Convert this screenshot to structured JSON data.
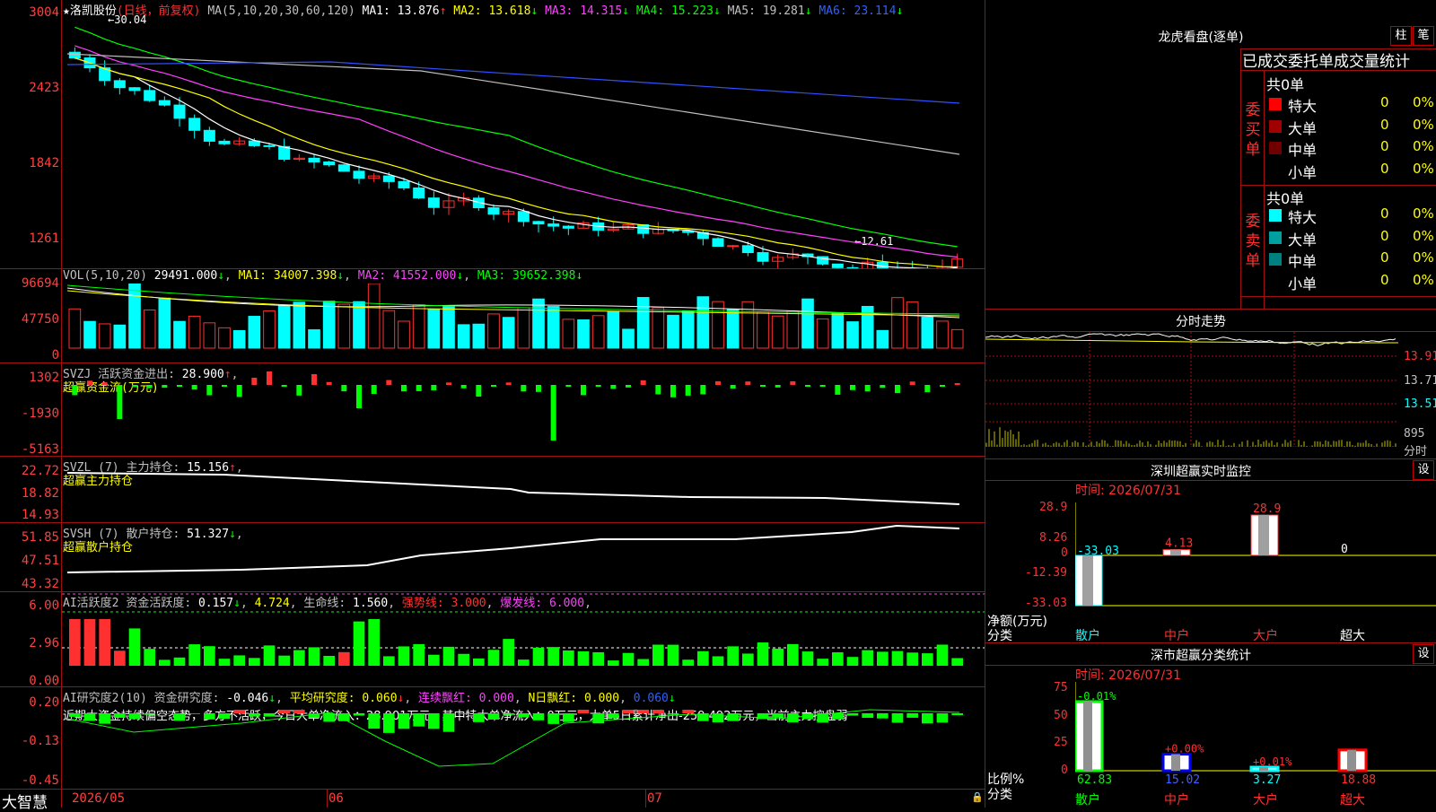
{
  "colors": {
    "up": "#ff3030",
    "down": "#00ffff",
    "ma1": "#ffffff",
    "ma2": "#ffff00",
    "ma3": "#ff40ff",
    "ma4": "#00ff00",
    "ma5": "#c0c0c0",
    "ma6": "#3050ff",
    "grid": "#a01010"
  },
  "main": {
    "stock_name": "洛凯股份",
    "mode": "(日线，前复权)",
    "ma_params": "MA(5,10,20,30,60,120)",
    "ma": [
      {
        "label": "MA1:",
        "value": "13.876",
        "arrow": "↑"
      },
      {
        "label": "MA2:",
        "value": "13.618",
        "arrow": "↓"
      },
      {
        "label": "MA3:",
        "value": "14.315",
        "arrow": "↓"
      },
      {
        "label": "MA4:",
        "value": "15.223",
        "arrow": "↓"
      },
      {
        "label": "MA5:",
        "value": "19.281",
        "arrow": "↓"
      },
      {
        "label": "MA6:",
        "value": "23.114",
        "arrow": "↓"
      }
    ],
    "y_ticks": [
      "3004",
      "2423",
      "1842",
      "1261"
    ],
    "high_label": "30.04",
    "low_label": "12.61"
  },
  "vol": {
    "title": "VOL(5,10,20)",
    "value": "29491.000",
    "ma": [
      {
        "label": "MA1:",
        "value": "34007.398",
        "arrow": "↓"
      },
      {
        "label": "MA2:",
        "value": "41552.000",
        "arrow": "↓"
      },
      {
        "label": "MA3:",
        "value": "39652.398",
        "arrow": "↓"
      }
    ],
    "y_ticks": [
      "96694",
      "47750",
      "0"
    ]
  },
  "svzj": {
    "title": "SVZJ",
    "label": "活跃资金进出:",
    "value": "28.900",
    "arrow": "↑",
    "sub": "超赢资金流(万元)",
    "y_ticks": [
      "1302",
      "-1930",
      "-5163"
    ]
  },
  "svzl": {
    "title": "SVZL (7)",
    "label": "主力持仓:",
    "value": "15.156",
    "arrow": "↑",
    "sub": "超赢主力持仓",
    "y_ticks": [
      "22.72",
      "18.82",
      "14.93"
    ]
  },
  "svsh": {
    "title": "SVSH (7)",
    "label": "散户持仓:",
    "value": "51.327",
    "arrow": "↓",
    "sub": "超赢散户持仓",
    "y_ticks": [
      "51.85",
      "47.51",
      "43.32"
    ]
  },
  "ai1": {
    "title": "AI活跃度2",
    "label": "资金活跃度:",
    "value": "0.157",
    "v2": "4.724",
    "life_label": "生命线:",
    "life": "1.560",
    "strong_label": "强势线:",
    "strong": "3.000",
    "burst_label": "爆发线:",
    "burst": "6.000",
    "y_ticks": [
      "6.00",
      "2.96",
      "0.00"
    ]
  },
  "ai2": {
    "title": "AI研究度2(10)",
    "label": "资金研究度:",
    "value": "-0.046",
    "avg_label": "平均研究度:",
    "avg": "0.060",
    "cont_label": "连续飘红:",
    "cont": "0.000",
    "nday_label": "N日飘红:",
    "nday": "0.000",
    "extra": "0.060",
    "comment": "近期大资金持续偏空态势，多方不活跃，今日大单净流入：28.901万元，其中特大单净流入：0万元，大单5日累计净出-259.492万元，当前主力控盘弱",
    "y_ticks": [
      "0.20",
      "-0.13",
      "-0.45"
    ]
  },
  "x_axis": {
    "brand": "大智慧",
    "labels": [
      "2026/05",
      "06",
      "07"
    ]
  },
  "lhb": {
    "title": "龙虎看盘(逐单)",
    "btn1": "柱",
    "btn2": "笔",
    "subtitle": "已成交委托单成交量统计",
    "buy_side": "委买单",
    "sell_side": "委卖单",
    "buy_total": "共0单",
    "sell_total": "共0单",
    "buy_rows": [
      {
        "name": "特大",
        "count": "0",
        "pct": "0%",
        "color": "#ff0000"
      },
      {
        "name": "大单",
        "count": "0",
        "pct": "0%",
        "color": "#a00000"
      },
      {
        "name": "中单",
        "count": "0",
        "pct": "0%",
        "color": "#700000"
      },
      {
        "name": "小单",
        "count": "0",
        "pct": "0%",
        "color": ""
      }
    ],
    "sell_rows": [
      {
        "name": "特大",
        "count": "0",
        "pct": "0%",
        "color": "#00ffff"
      },
      {
        "name": "大单",
        "count": "0",
        "pct": "0%",
        "color": "#00a0a0"
      },
      {
        "name": "中单",
        "count": "0",
        "pct": "0%",
        "color": "#008080"
      },
      {
        "name": "小单",
        "count": "0",
        "pct": "0%",
        "color": ""
      }
    ]
  },
  "intraday": {
    "title": "分时走势",
    "y_ticks": [
      "13.91",
      "13.71",
      "13.51"
    ],
    "vol_tick": "895",
    "vol_label": "分时"
  },
  "szmon": {
    "title": "深圳超赢实时监控",
    "btn": "设",
    "time_label": "时间:",
    "time": "2026/07/31",
    "y_ticks": [
      "28.9",
      "8.26",
      "0",
      "-12.39",
      "-33.03"
    ],
    "y_label": "净额(万元)",
    "x_label": "分类",
    "chart_data": {
      "type": "bar",
      "categories": [
        "散户",
        "中户",
        "大户",
        "超大"
      ],
      "values": [
        -33.03,
        4.13,
        28.9,
        0
      ],
      "value_labels": [
        "-33.03",
        "4.13",
        "28.9",
        "0"
      ],
      "ylim": [
        -33.03,
        28.9
      ]
    }
  },
  "szcls": {
    "title": "深市超赢分类统计",
    "btn": "设",
    "time_label": "时间:",
    "time": "2026/07/31",
    "y_ticks": [
      "75",
      "50",
      "25",
      "0"
    ],
    "y_label": "比例%",
    "x_label": "分类",
    "chart_data": {
      "type": "bar",
      "categories": [
        "散户",
        "中户",
        "大户",
        "超大"
      ],
      "values": [
        62.83,
        15.02,
        3.27,
        18.88
      ],
      "change_labels": [
        "-0.01%",
        "+0.00%",
        "+0.01%",
        ""
      ],
      "ylim": [
        0,
        75
      ]
    }
  }
}
